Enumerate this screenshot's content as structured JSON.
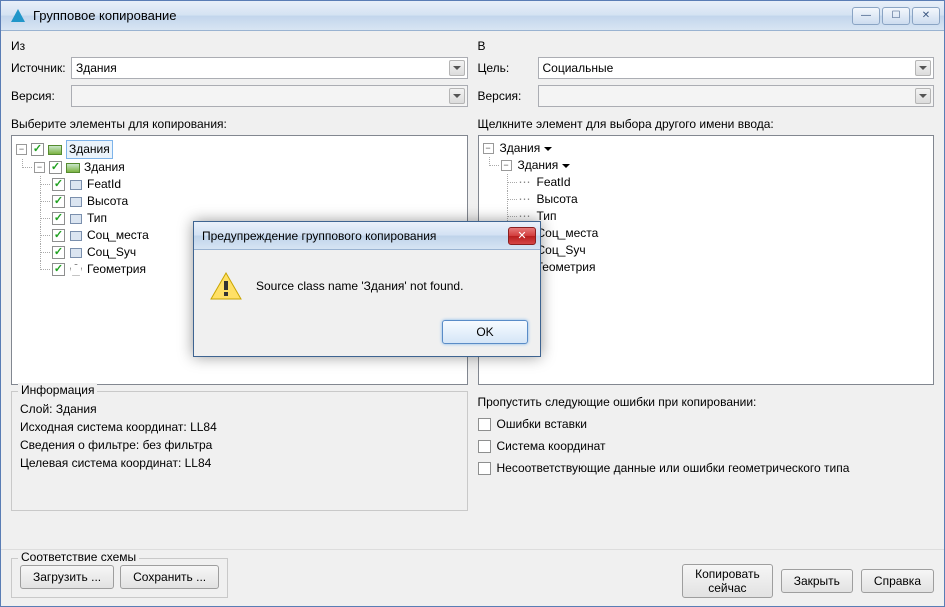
{
  "window": {
    "title": "Групповое копирование",
    "btn_min": "—",
    "btn_max": "☐",
    "btn_close": "✕"
  },
  "left": {
    "header": "Из",
    "source_label": "Источник:",
    "source_value": "Здания",
    "version_label": "Версия:",
    "tree_label": "Выберите элементы для копирования:",
    "tree": {
      "root": "Здания",
      "layer": "Здания",
      "fields": [
        "FeatId",
        "Высота",
        "Тип",
        "Соц_места",
        "Соц_Syч",
        "Геометрия"
      ]
    },
    "info": {
      "title": "Информация",
      "layer_row": "Слой: Здания",
      "src_cs": "Исходная система координат: LL84",
      "filter": "Сведения о фильтре: без фильтра",
      "dst_cs": "Целевая система координат: LL84"
    }
  },
  "right": {
    "header": "В",
    "target_label": "Цель:",
    "target_value": "Социальные",
    "version_label": "Версия:",
    "tree_label": "Щелкните элемент для выбора другого имени ввода:",
    "tree": {
      "root": "Здания",
      "layer": "Здания",
      "fields": [
        "FeatId",
        "Высота",
        "Тип",
        "Соц_места",
        "Соц_Syч",
        "Геометрия"
      ]
    },
    "skip": {
      "title": "Пропустить следующие ошибки при копировании:",
      "opt1": "Ошибки вставки",
      "opt2": "Система координат",
      "opt3": "Несоответствующие данные или ошибки геометрического типа"
    }
  },
  "footer": {
    "schema_title": "Соответствие схемы",
    "load": "Загрузить ...",
    "save": "Сохранить ...",
    "copy_now": "Копировать\nсейчас",
    "close": "Закрыть",
    "help": "Справка"
  },
  "modal": {
    "title": "Предупреждение группового копирования",
    "message": "Source class name 'Здания' not found.",
    "ok": "OK",
    "close": "✕"
  }
}
